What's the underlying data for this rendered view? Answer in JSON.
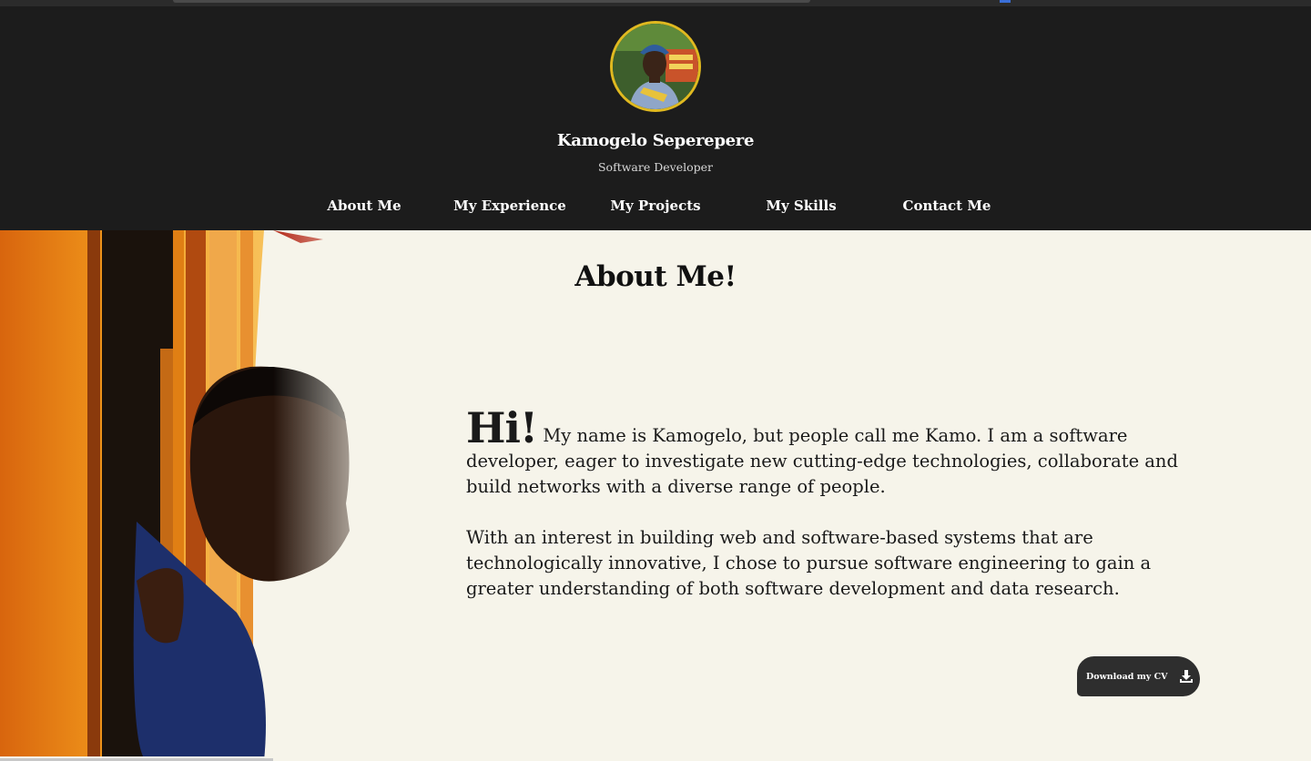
{
  "profile": {
    "name": "Kamogelo Seperepere",
    "role": "Software Developer"
  },
  "nav": {
    "items": [
      "About Me",
      "My Experience",
      "My Projects",
      "My Skills",
      "Contact Me"
    ]
  },
  "about": {
    "heading": "About Me!",
    "hi": "Hi!",
    "paragraph1": "My name is Kamogelo, but people call me Kamo. I am a software developer, eager to investigate new cutting-edge technologies, collaborate and build networks with a diverse range of people.",
    "paragraph2": "With an interest in building web and software-based systems that are technologically innovative, I chose to pursue software engineering to gain a greater understanding of both software development and data research."
  },
  "cv_button": {
    "label": "Download my CV",
    "icon": "download-icon"
  },
  "colors": {
    "header_bg": "#1c1c1c",
    "page_bg": "#f6f4ea",
    "avatar_border": "#e0b920",
    "button_bg": "#2e2e2e"
  }
}
